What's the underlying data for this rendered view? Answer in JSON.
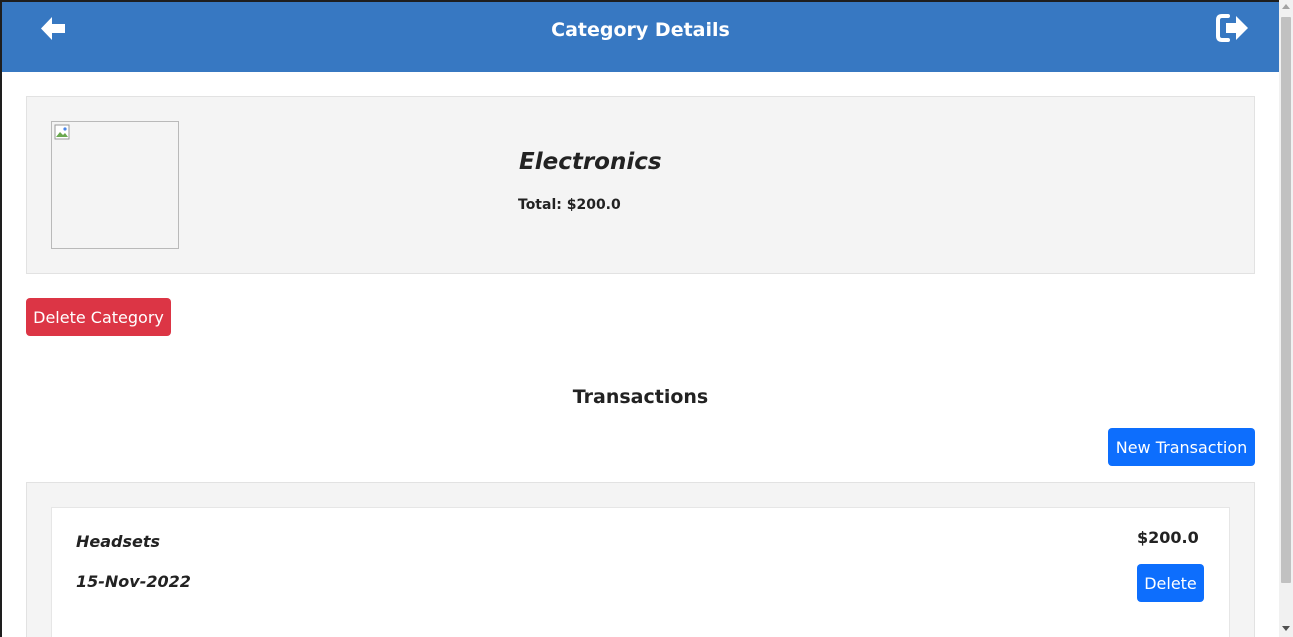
{
  "navbar": {
    "title": "Category Details",
    "back_icon": "arrow-left-icon",
    "logout_icon": "sign-out-icon",
    "color": "#3778c2"
  },
  "category": {
    "image_icon": "broken-image-icon",
    "name": "Electronics",
    "total": "Total: $200.0",
    "delete_label": "Delete Category"
  },
  "transactions": {
    "title": "Transactions",
    "new_label": "New Transaction",
    "items": [
      {
        "name": "Headsets",
        "date": "15-Nov-2022",
        "amount": "$200.0",
        "delete_label": "Delete"
      }
    ]
  },
  "colors": {
    "danger": "#dc3545",
    "primary": "#0d6efd",
    "panel": "#f4f4f4"
  }
}
